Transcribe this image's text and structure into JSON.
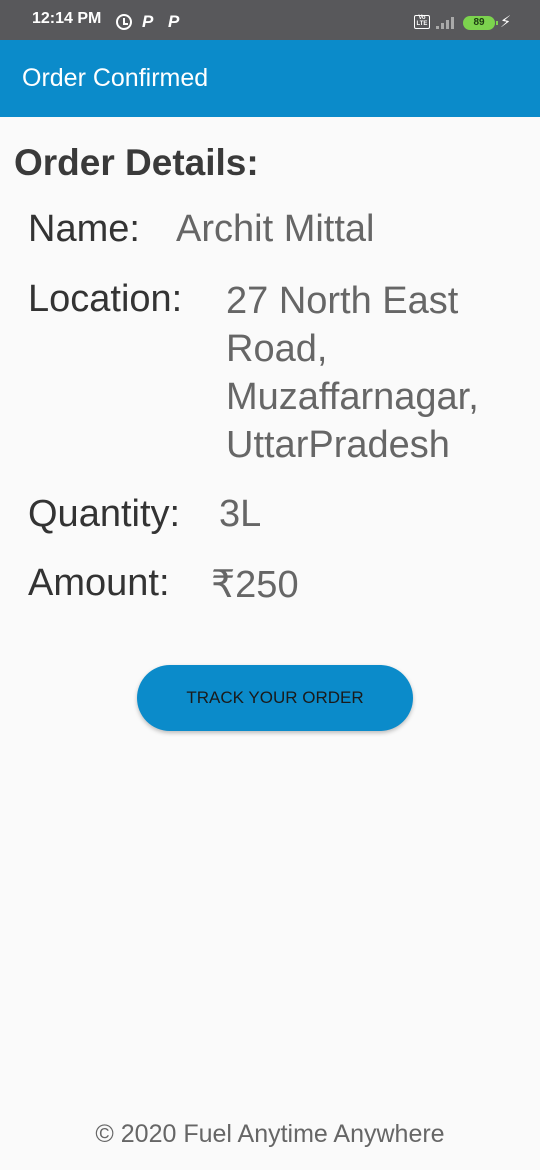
{
  "status_bar": {
    "time": "12:14 PM",
    "notification_icons": [
      "alarm-icon",
      "p-icon",
      "p-icon"
    ],
    "p_glyph": "P",
    "volte_label": "Vo\nLTE",
    "battery_level": "89",
    "charging": true
  },
  "app_bar": {
    "title": "Order Confirmed",
    "color": "#0b8bca"
  },
  "order": {
    "section_title": "Order Details:",
    "name_label": "Name:",
    "name_value": "Archit Mittal",
    "location_label": "Location:",
    "location_value": "27 North East Road, Muzaffarnagar, UttarPradesh",
    "quantity_label": "Quantity:",
    "quantity_value": "3L",
    "amount_label": "Amount:",
    "amount_value": "₹250"
  },
  "actions": {
    "track_label": "TRACK YOUR ORDER"
  },
  "footer": {
    "text": "© 2020 Fuel Anytime Anywhere"
  }
}
